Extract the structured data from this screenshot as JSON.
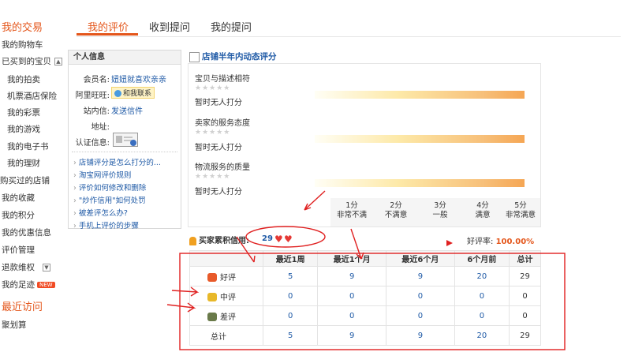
{
  "sidebar": {
    "section1": "我的交易",
    "items": [
      "我的购物车",
      "已买到的宝贝",
      "我的拍卖",
      "机票酒店保险",
      "我的彩票",
      "我的游戏",
      "我的电子书",
      "我的理财",
      "购买过的店铺",
      "我的收藏",
      "我的积分",
      "我的优惠信息",
      "评价管理",
      "退款维权",
      "我的足迹"
    ],
    "new_badge": "NEW",
    "section2": "最近访问",
    "recent": "聚划算"
  },
  "tabs": [
    "我的评价",
    "收到提问",
    "我的提问"
  ],
  "info": {
    "title": "个人信息",
    "member_label": "会员名:",
    "member_value": "妞妞就喜欢亲亲",
    "wangwang_label": "阿里旺旺:",
    "wangwang_value": "和我联系",
    "mail_label": "站内信:",
    "mail_value": "发送信件",
    "address_label": "地址:",
    "auth_label": "认证信息:",
    "links": [
      "店铺评分是怎么打分的...",
      "淘宝网评价规则",
      "评价如何修改和删除",
      "\"炒作信用\"如何处罚",
      "被差评怎么办?",
      "手机上评价的步骤"
    ]
  },
  "rating": {
    "title": "店铺半年内动态评分",
    "items": [
      {
        "label": "宝贝与描述相符",
        "stars": "★★★★★",
        "status": "暂时无人打分"
      },
      {
        "label": "卖家的服务态度",
        "stars": "★★★★★",
        "status": "暂时无人打分"
      },
      {
        "label": "物流服务的质量",
        "stars": "★★★★★",
        "status": "暂时无人打分"
      }
    ],
    "scale": [
      {
        "score": "1分",
        "text": "非常不满"
      },
      {
        "score": "2分",
        "text": "不满意"
      },
      {
        "score": "3分",
        "text": "一般"
      },
      {
        "score": "4分",
        "text": "满意"
      },
      {
        "score": "5分",
        "text": "非常满意"
      }
    ]
  },
  "buyer": {
    "label": "买家累积信用:",
    "credit": "29",
    "praise_label": "好评率:",
    "praise_value": "100.00%"
  },
  "table": {
    "headers": [
      "",
      "最近1周",
      "最近1个月",
      "最近6个月",
      "6个月前",
      "总计"
    ],
    "rows": [
      {
        "label": "好评",
        "icon": "flower-good-icon",
        "values": [
          "5",
          "9",
          "9",
          "20",
          "29"
        ]
      },
      {
        "label": "中评",
        "icon": "flower-neutral-icon",
        "values": [
          "0",
          "0",
          "0",
          "0",
          "0"
        ]
      },
      {
        "label": "差评",
        "icon": "flower-bad-icon",
        "values": [
          "0",
          "0",
          "0",
          "0",
          "0"
        ]
      },
      {
        "label": "总计",
        "icon": "",
        "values": [
          "5",
          "9",
          "9",
          "20",
          "29"
        ]
      }
    ]
  },
  "colors": {
    "accent": "#e4561b",
    "link": "#1f5aa6",
    "annotation": "#e02020"
  }
}
